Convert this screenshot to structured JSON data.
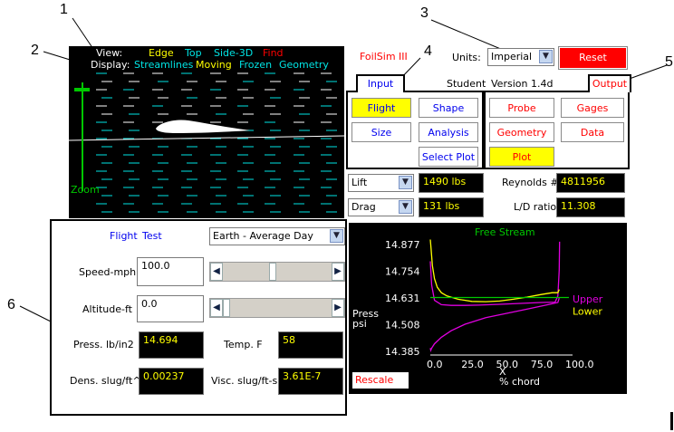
{
  "callouts": [
    "1",
    "2",
    "3",
    "4",
    "5",
    "6"
  ],
  "viewer": {
    "view_label": "View:",
    "view_options": [
      "Edge",
      "Top",
      "Side-3D",
      "Find"
    ],
    "display_label": "Display:",
    "display_options": [
      "Streamlines",
      "Moving",
      "Frozen",
      "Geometry"
    ],
    "zoom_label": "Zoom"
  },
  "header": {
    "app_name": "FoilSim III",
    "units_label": "Units:",
    "units_value": "Imperial",
    "reset_label": "Reset",
    "student_label": "Student",
    "version_label": "Version 1.4d"
  },
  "input_panel": {
    "tab_label": "Input",
    "buttons": [
      "Flight",
      "Shape",
      "Size",
      "Analysis",
      "Select Plot"
    ]
  },
  "output_panel": {
    "tab_label": "Output",
    "buttons": [
      "Probe",
      "Gages",
      "Geometry",
      "Data",
      "Plot"
    ]
  },
  "results": {
    "select1": "Lift",
    "value1": "1490 lbs",
    "reynolds_label": "Reynolds #",
    "reynolds_value": "4811956",
    "select2": "Drag",
    "value2": "131 lbs",
    "ld_label": "L/D ratio",
    "ld_value": "11.308"
  },
  "flight_panel": {
    "title1": "Flight",
    "title2": "Test",
    "environment": "Earth - Average Day",
    "speed_label": "Speed-mph",
    "speed_value": "100.0",
    "speed_level": 0.45,
    "altitude_label": "Altitude-ft",
    "altitude_value": "0.0",
    "altitude_level": 0.0,
    "press_label": "Press. lb/in2",
    "press_value": "14.694",
    "temp_label": "Temp. F",
    "temp_value": "58",
    "dens_label": "Dens. slug/ft^3",
    "dens_value": "0.00237",
    "visc_label": "Visc. slug/ft-s",
    "visc_value": "3.61E-7"
  },
  "colors": {
    "yellow": "#ffff00",
    "cyan": "#00e5e5",
    "red": "#ff0000",
    "magenta": "#e000e0",
    "green": "#00c800",
    "blue": "#0000ee"
  },
  "chart_data": {
    "type": "line",
    "title": "Free Stream",
    "ylabel": "Press\npsi",
    "xlabel": "X\n% chord",
    "yticks": [
      "14.877",
      "14.754",
      "14.631",
      "14.508",
      "14.385"
    ],
    "xticks": [
      "0.0",
      "25.0",
      "50.0",
      "75.0",
      "100.0"
    ],
    "xlim": [
      0,
      100
    ],
    "ylim": [
      14.385,
      14.877
    ],
    "rescale_label": "Rescale",
    "series": [
      {
        "name": "Upper",
        "color": "#e000e0",
        "x": [
          0,
          1,
          3,
          8,
          15,
          25,
          35,
          50,
          65,
          80,
          90,
          92,
          93,
          93.3
        ],
        "y": [
          14.8,
          14.69,
          14.62,
          14.6,
          14.597,
          14.597,
          14.598,
          14.602,
          14.606,
          14.61,
          14.612,
          14.64,
          14.76,
          14.89
        ]
      },
      {
        "name": "Lower",
        "color": "#ffff00",
        "x": [
          0,
          0.5,
          1.5,
          3,
          5,
          8,
          12,
          20,
          30,
          40,
          50,
          60,
          70,
          80,
          88,
          92,
          93
        ],
        "y": [
          14.9,
          14.86,
          14.78,
          14.72,
          14.68,
          14.655,
          14.64,
          14.625,
          14.615,
          14.614,
          14.617,
          14.625,
          14.635,
          14.647,
          14.655,
          14.655,
          14.67
        ]
      },
      {
        "name": "",
        "color": "#00c800",
        "x": [
          0,
          100
        ],
        "y": [
          14.633,
          14.633
        ]
      },
      {
        "name": "",
        "color": "#e000e0",
        "x": [
          0,
          0.3,
          1,
          3,
          8,
          15,
          25,
          40,
          55,
          70,
          85,
          92,
          93
        ],
        "y": [
          14.4,
          14.39,
          14.4,
          14.42,
          14.45,
          14.48,
          14.51,
          14.54,
          14.56,
          14.58,
          14.6,
          14.61,
          14.63
        ]
      }
    ]
  }
}
